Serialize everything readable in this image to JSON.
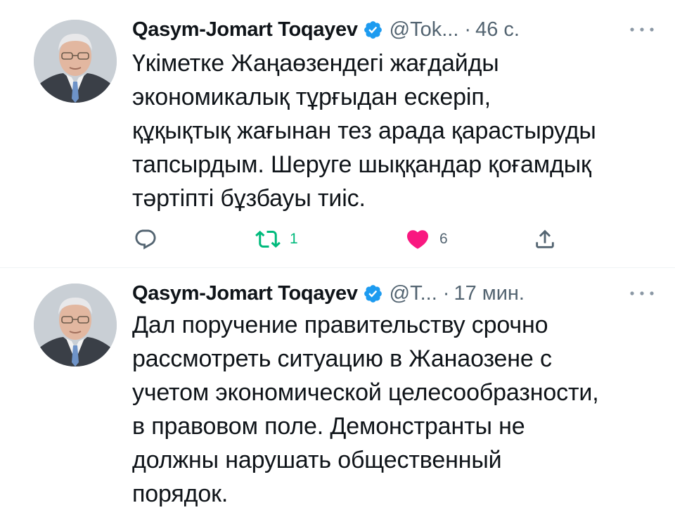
{
  "tweets": [
    {
      "author_name": "Qasym-Jomart Toqayev",
      "handle": "@Tok...",
      "separator": "·",
      "time": "46 с.",
      "lines": [
        "Үкіметке Жаңаөзендегі жағдайды",
        "экономикалық тұрғыдан ескеріп,",
        "құқықтық жағынан тез арада қарастыруды",
        "тапсырдым. Шеруге шыққандар қоғамдық",
        "тәртіпті бұзбауы тиіс."
      ],
      "retweet_count": "1",
      "like_count": "6"
    },
    {
      "author_name": "Qasym-Jomart Toqayev",
      "handle": "@T...",
      "separator": "·",
      "time": "17 мин.",
      "lines": [
        "Дал поручение правительству срочно",
        "рассмотреть ситуацию в Жанаозене с",
        "учетом экономической целесообразности,",
        "в правовом поле. Демонстранты не",
        "должны нарушать общественный",
        "порядок."
      ]
    }
  ],
  "icons": {
    "verified": "verified-badge-icon",
    "more": "more-dots-icon",
    "reply": "reply-icon",
    "retweet": "retweet-icon",
    "like": "heart-icon",
    "share": "share-icon"
  },
  "colors": {
    "verified_blue": "#1d9bf0",
    "retweet_green": "#00ba7c",
    "like_pink": "#f91880",
    "secondary_text": "#536471",
    "separator": "#eff3f4"
  }
}
